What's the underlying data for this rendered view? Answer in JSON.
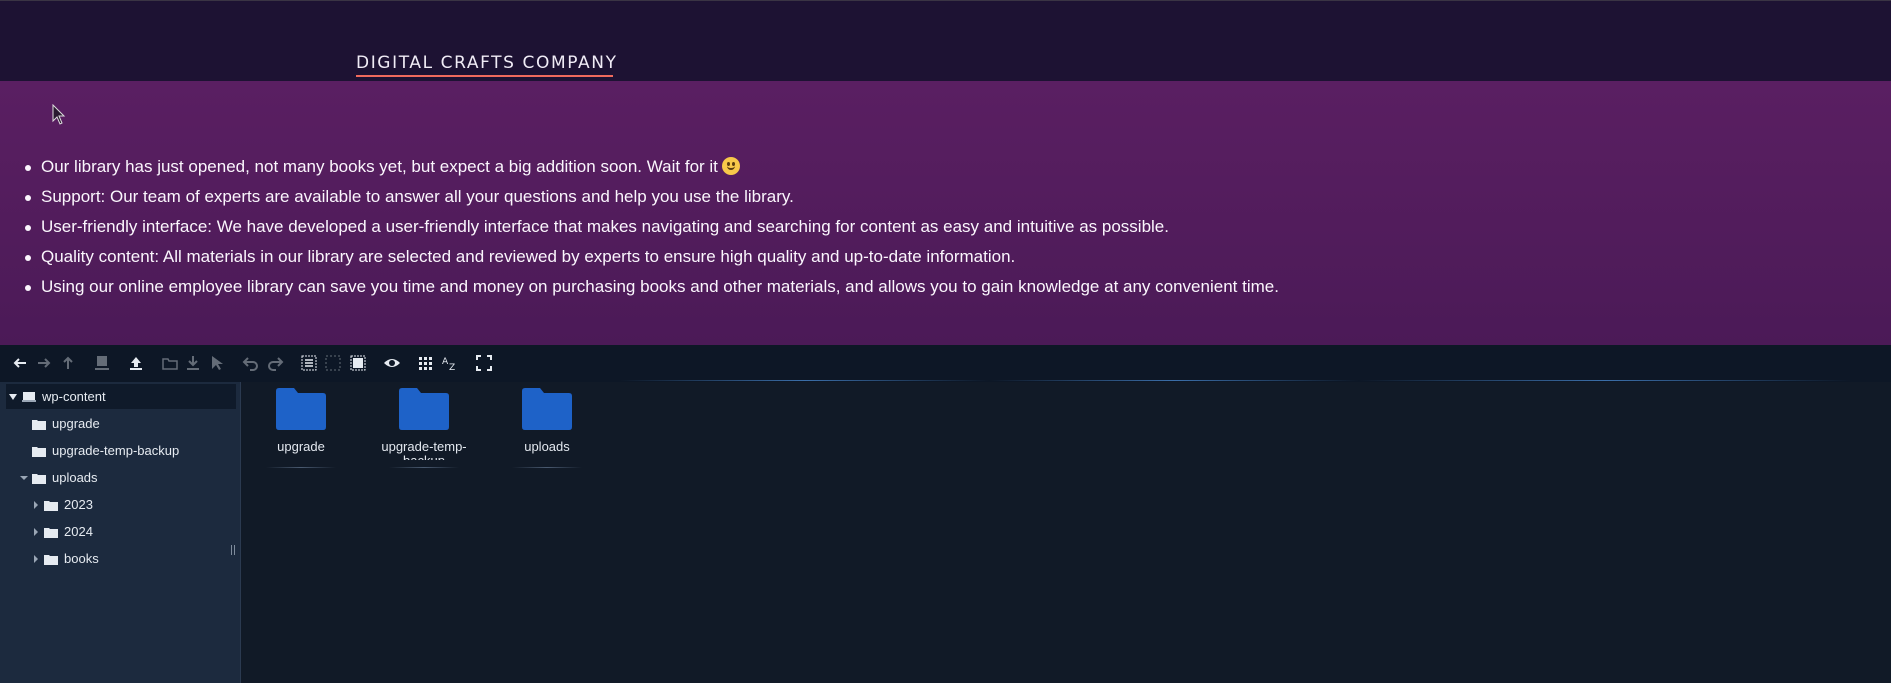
{
  "header": {
    "company": "DIGITAL CRAFTS COMPANY"
  },
  "hero": {
    "bullets": [
      "Our library has just opened, not many books yet, but expect a big addition soon. Wait for it",
      "Support: Our team of experts are available to answer all your questions and help you use the library.",
      "User-friendly interface: We have developed a user-friendly interface that makes navigating and searching for content as easy and intuitive as possible.",
      "Quality content: All materials in our library are selected and reviewed by experts to ensure high quality and up-to-date information.",
      "Using our online employee library can save you time and money on purchasing books and other materials, and allows you to gain knowledge at any convenient time."
    ]
  },
  "toolbar": {
    "buttons": [
      "back-icon",
      "forward-icon",
      "up-icon",
      "download-file-icon",
      "upload-icon",
      "new-folder-icon",
      "extract-icon",
      "select-cursor-icon",
      "undo-icon",
      "redo-icon",
      "select-all-icon",
      "select-none-icon",
      "invert-selection-icon",
      "preview-icon",
      "grid-view-icon",
      "sort-az-icon",
      "fullscreen-icon"
    ]
  },
  "tree": {
    "root": "wp-content",
    "items": [
      {
        "label": "upgrade"
      },
      {
        "label": "upgrade-temp-backup"
      },
      {
        "label": "uploads"
      },
      {
        "label": "2023"
      },
      {
        "label": "2024"
      },
      {
        "label": "books"
      }
    ]
  },
  "files": [
    {
      "name": "upgrade"
    },
    {
      "name": "upgrade-temp-backup"
    },
    {
      "name": "uploads"
    }
  ],
  "colors": {
    "header_bg": "#1d1233",
    "hero_bg": "#5a1f62",
    "accent_underline": "#f06a5d",
    "folder_blue": "#1e62c8",
    "panel_bg": "#111a27",
    "sidebar_bg": "#1c2a3e"
  }
}
